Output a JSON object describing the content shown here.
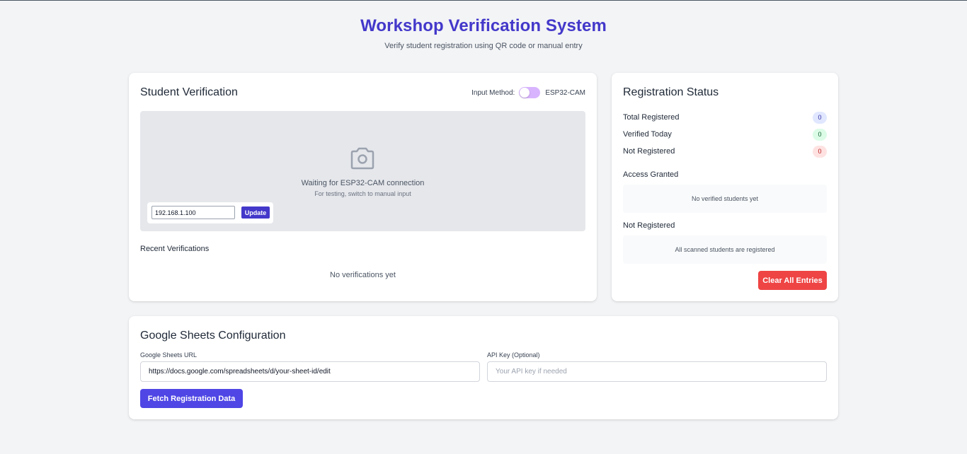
{
  "header": {
    "title": "Workshop Verification System",
    "subtitle": "Verify student registration using QR code or manual entry"
  },
  "verification": {
    "title": "Student Verification",
    "input_method_label": "Input Method:",
    "input_method_value": "ESP32-CAM",
    "camera_icon": "camera-icon",
    "camera_message": "Waiting for ESP32-CAM connection",
    "camera_hint": "For testing, switch to manual input",
    "ip_value": "192.168.1.100",
    "update_label": "Update",
    "recent_title": "Recent Verifications",
    "recent_empty": "No verifications yet"
  },
  "status": {
    "title": "Registration Status",
    "stats": [
      {
        "label": "Total Registered",
        "value": "0",
        "color": "#e0e7ff"
      },
      {
        "label": "Verified Today",
        "value": "0",
        "color": "#dcfce7"
      },
      {
        "label": "Not Registered",
        "value": "0",
        "color": "#fee2e2"
      }
    ],
    "access_granted_label": "Access Granted",
    "access_granted_empty": "No verified students yet",
    "not_registered_label": "Not Registered",
    "not_registered_empty": "All scanned students are registered",
    "clear_label": "Clear All Entries"
  },
  "sheets": {
    "title": "Google Sheets Configuration",
    "url_label": "Google Sheets URL",
    "url_value": "https://docs.google.com/spreadsheets/d/your-sheet-id/edit",
    "api_label": "API Key (Optional)",
    "api_placeholder": "Your API key if needed",
    "fetch_label": "Fetch Registration Data"
  },
  "colors": {
    "accent": "#4338ca",
    "danger": "#ef4444",
    "button": "#4f46e5",
    "toggle": "#d8b4fe"
  }
}
